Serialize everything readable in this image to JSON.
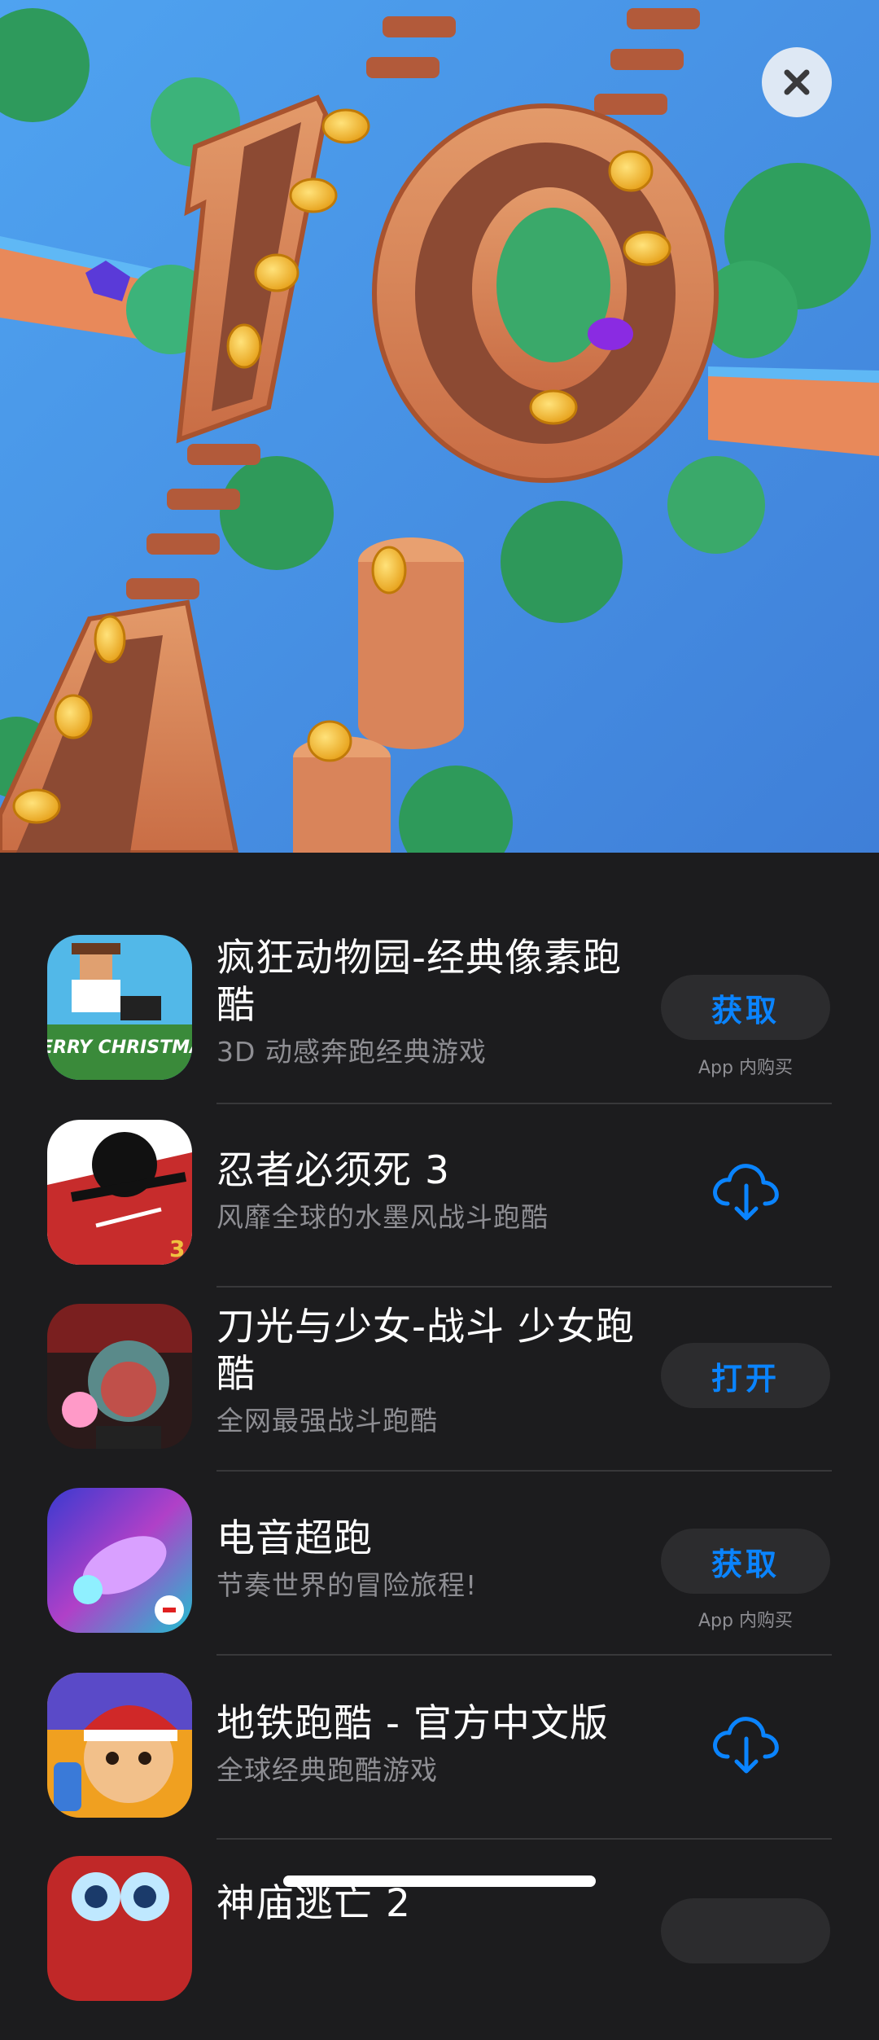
{
  "hero": {
    "title_art": "10"
  },
  "apps": [
    {
      "name": "疯狂动物园-经典像素跑酷",
      "subtitle": "3D 动感奔跑经典游戏",
      "action": "获取",
      "iap_note": "App 内购买",
      "icon": "crossy-road-icon",
      "icon_text": "MERRY CHRISTMAS"
    },
    {
      "name": "忍者必须死 3",
      "subtitle": "风靡全球的水墨风战斗跑酷",
      "action": "download",
      "icon": "ninja-icon",
      "icon_text": "3"
    },
    {
      "name": "刀光与少女-战斗 少女跑酷",
      "subtitle": "全网最强战斗跑酷",
      "action": "打开",
      "icon": "blade-girl-icon"
    },
    {
      "name": "电音超跑",
      "subtitle": "节奏世界的冒险旅程!",
      "action": "获取",
      "iap_note": "App 内购买",
      "icon": "music-racer-icon"
    },
    {
      "name": "地铁跑酷 - 官方中文版",
      "subtitle": "全球经典跑酷游戏",
      "action": "download",
      "icon": "subway-surfers-icon"
    },
    {
      "name": "神庙逃亡 2",
      "icon": "temple-run-icon"
    }
  ],
  "colors": {
    "accent": "#0a84ff",
    "background": "#1c1c1e",
    "button": "#2c2c2e",
    "secondary_text": "#8e8e93"
  }
}
